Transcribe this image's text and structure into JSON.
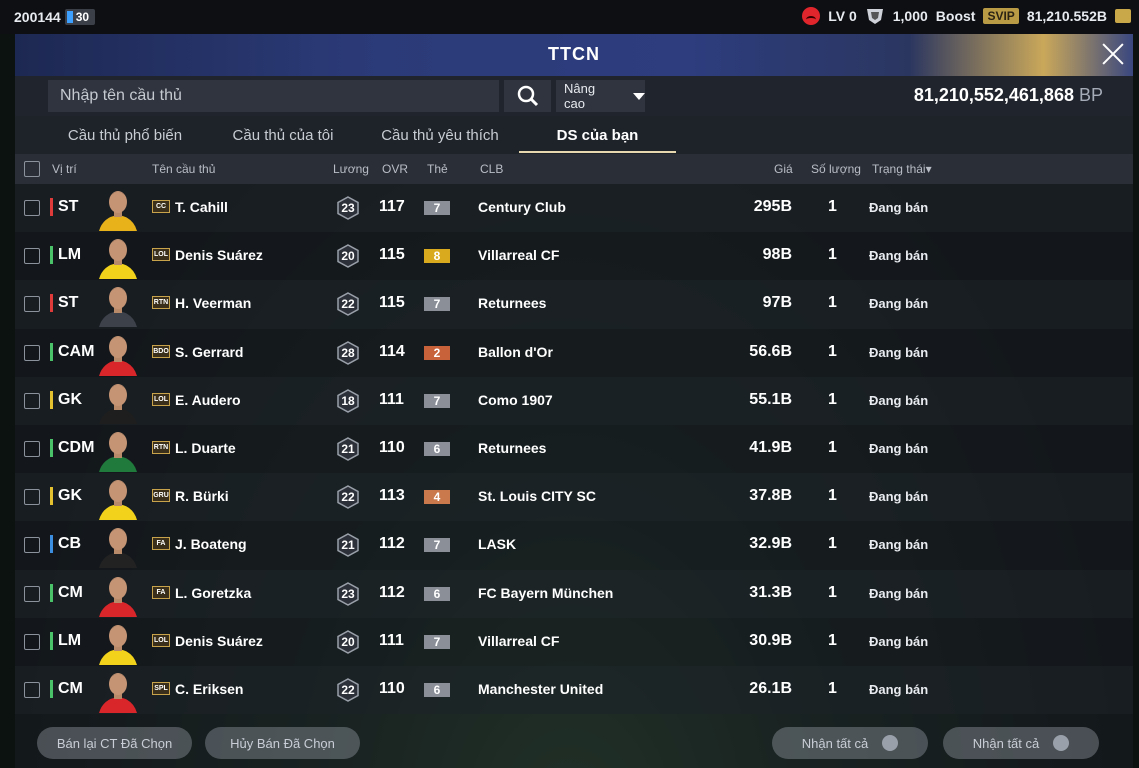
{
  "topbar": {
    "user_id": "200144",
    "energy": "30",
    "level": "LV 0",
    "tokens": "1,000",
    "boost_label": "Boost",
    "svip": "SVIP",
    "balance": "81,210.552B"
  },
  "header": {
    "title": "TTCN"
  },
  "search": {
    "placeholder": "Nhập tên cầu thủ",
    "advanced": "Nâng cao",
    "bp_value": "81,210,552,461,868",
    "bp_unit": "BP"
  },
  "tabs": [
    {
      "label": "Cầu thủ phổ biến"
    },
    {
      "label": "Cầu thủ của tôi"
    },
    {
      "label": "Cầu thủ yêu thích"
    },
    {
      "label": "DS của bạn"
    }
  ],
  "columns": {
    "position": "Vị trí",
    "name": "Tên cầu thủ",
    "wage": "Lương",
    "ovr": "OVR",
    "grade": "Thẻ",
    "club": "CLB",
    "price": "Giá",
    "qty": "Số lượng",
    "status": "Trạng thái▾"
  },
  "players": [
    {
      "pos": "ST",
      "line": "a",
      "season": "CC",
      "name": "T. Cahill",
      "wage": "23",
      "ovr": "117",
      "grade": "7",
      "club": "Century Club",
      "price": "295B",
      "qty": "1",
      "status": "Đang bán"
    },
    {
      "pos": "LM",
      "line": "m",
      "season": "LOL",
      "name": "Denis Suárez",
      "wage": "20",
      "ovr": "115",
      "grade": "8",
      "club": "Villarreal CF",
      "price": "98B",
      "qty": "1",
      "status": "Đang bán"
    },
    {
      "pos": "ST",
      "line": "a",
      "season": "RTN",
      "name": "H. Veerman",
      "wage": "22",
      "ovr": "115",
      "grade": "7",
      "club": "Returnees",
      "price": "97B",
      "qty": "1",
      "status": "Đang bán"
    },
    {
      "pos": "CAM",
      "line": "m",
      "season": "BDO",
      "name": "S. Gerrard",
      "wage": "28",
      "ovr": "114",
      "grade": "2",
      "club": "Ballon d'Or",
      "price": "56.6B",
      "qty": "1",
      "status": "Đang bán"
    },
    {
      "pos": "GK",
      "line": "g",
      "season": "LOL",
      "name": "E. Audero",
      "wage": "18",
      "ovr": "111",
      "grade": "7",
      "club": "Como 1907",
      "price": "55.1B",
      "qty": "1",
      "status": "Đang bán"
    },
    {
      "pos": "CDM",
      "line": "m",
      "season": "RTN",
      "name": "L. Duarte",
      "wage": "21",
      "ovr": "110",
      "grade": "6",
      "club": "Returnees",
      "price": "41.9B",
      "qty": "1",
      "status": "Đang bán"
    },
    {
      "pos": "GK",
      "line": "g",
      "season": "GRU",
      "name": "R. Bürki",
      "wage": "22",
      "ovr": "113",
      "grade": "4",
      "club": "St. Louis CITY SC",
      "price": "37.8B",
      "qty": "1",
      "status": "Đang bán"
    },
    {
      "pos": "CB",
      "line": "d",
      "season": "FA",
      "name": "J. Boateng",
      "wage": "21",
      "ovr": "112",
      "grade": "7",
      "club": "LASK",
      "price": "32.9B",
      "qty": "1",
      "status": "Đang bán"
    },
    {
      "pos": "CM",
      "line": "m",
      "season": "FA",
      "name": "L. Goretzka",
      "wage": "23",
      "ovr": "112",
      "grade": "6",
      "club": "FC Bayern München",
      "price": "31.3B",
      "qty": "1",
      "status": "Đang bán"
    },
    {
      "pos": "LM",
      "line": "m",
      "season": "LOL",
      "name": "Denis Suárez",
      "wage": "20",
      "ovr": "111",
      "grade": "7",
      "club": "Villarreal CF",
      "price": "30.9B",
      "qty": "1",
      "status": "Đang bán"
    },
    {
      "pos": "CM",
      "line": "m",
      "season": "SPL",
      "name": "C. Eriksen",
      "wage": "22",
      "ovr": "110",
      "grade": "6",
      "club": "Manchester United",
      "price": "26.1B",
      "qty": "1",
      "status": "Đang bán"
    }
  ],
  "grade_colors": {
    "2": "#c7623a",
    "4": "#c9794b",
    "6": "#8a8f98",
    "7": "#8a8f98",
    "8": "#d9aa1e"
  },
  "kit_colors": [
    "#e7b21a",
    "#f2d21a",
    "#3d4149",
    "#d9262b",
    "#1e1e1e",
    "#1f7a3c",
    "#f2d21a",
    "#222222",
    "#d9262b",
    "#f2d21a",
    "#d9262b"
  ],
  "buttons": {
    "resell": "Bán lại CT Đã Chọn",
    "cancel": "Hủy Bán Đã Chọn",
    "claim_all_1": "Nhận tất cả",
    "claim_all_2": "Nhận tất cả"
  }
}
